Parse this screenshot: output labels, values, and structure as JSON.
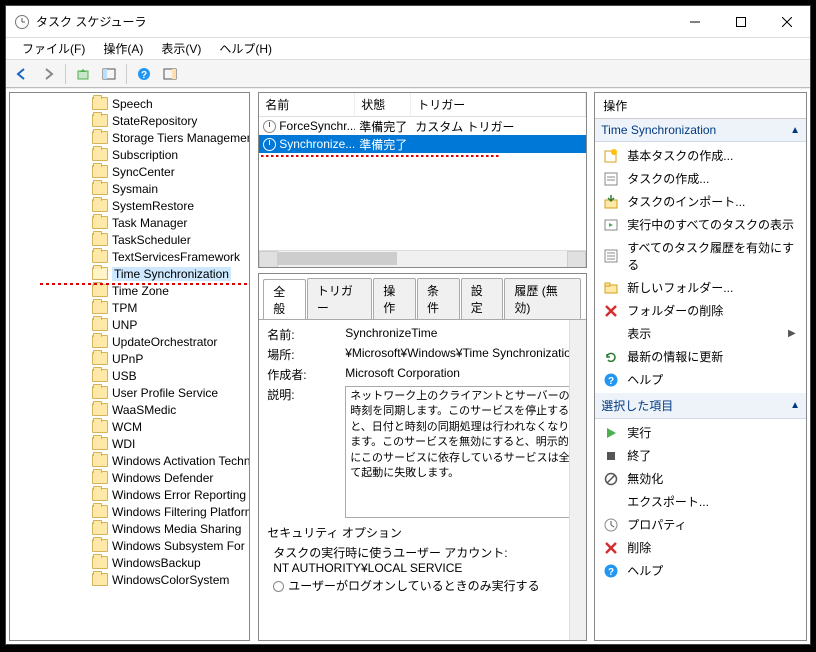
{
  "window": {
    "title": "タスク スケジューラ"
  },
  "menu": {
    "file": "ファイル(F)",
    "action": "操作(A)",
    "view": "表示(V)",
    "help": "ヘルプ(H)"
  },
  "tree": {
    "items": [
      "Speech",
      "StateRepository",
      "Storage Tiers Management",
      "Subscription",
      "SyncCenter",
      "Sysmain",
      "SystemRestore",
      "Task Manager",
      "TaskScheduler",
      "TextServicesFramework",
      "Time Synchronization",
      "Time Zone",
      "TPM",
      "UNP",
      "UpdateOrchestrator",
      "UPnP",
      "USB",
      "User Profile Service",
      "WaaSMedic",
      "WCM",
      "WDI",
      "Windows Activation Technologies",
      "Windows Defender",
      "Windows Error Reporting",
      "Windows Filtering Platform",
      "Windows Media Sharing",
      "Windows Subsystem For Linux",
      "WindowsBackup",
      "WindowsColorSystem"
    ],
    "selected_index": 10
  },
  "task_list": {
    "columns": {
      "name": "名前",
      "status": "状態",
      "trigger": "トリガー"
    },
    "rows": [
      {
        "name": "ForceSynchr...",
        "status": "準備完了",
        "trigger": "カスタム トリガー"
      },
      {
        "name": "Synchronize...",
        "status": "準備完了",
        "trigger": ""
      }
    ],
    "selected_index": 1
  },
  "tabs": {
    "general": "全般",
    "triggers": "トリガー",
    "actions": "操作",
    "conditions": "条件",
    "settings": "設定",
    "history": "履歴 (無効)"
  },
  "detail": {
    "labels": {
      "name": "名前:",
      "location": "場所:",
      "author": "作成者:",
      "description": "説明:"
    },
    "name": "SynchronizeTime",
    "location": "¥Microsoft¥Windows¥Time Synchronization",
    "author": "Microsoft Corporation",
    "description": "ネットワーク上のクライアントとサーバーの時刻を同期します。このサービスを停止すると、日付と時刻の同期処理は行われなくなります。このサービスを無効にすると、明示的にこのサービスに依存しているサービスは全て起動に失敗します。",
    "security": {
      "title": "セキュリティ オプション",
      "account_label": "タスクの実行時に使うユーザー アカウント:",
      "account": "NT AUTHORITY¥LOCAL SERVICE",
      "option_loggedon": "ユーザーがログオンしているときのみ実行する"
    }
  },
  "actions_pane": {
    "header": "操作",
    "section1": "Time Synchronization",
    "section2": "選択した項目",
    "items1": [
      {
        "icon": "new-basic",
        "label": "基本タスクの作成..."
      },
      {
        "icon": "new-task",
        "label": "タスクの作成..."
      },
      {
        "icon": "import",
        "label": "タスクのインポート..."
      },
      {
        "icon": "running",
        "label": "実行中のすべてのタスクの表示"
      },
      {
        "icon": "history",
        "label": "すべてのタスク履歴を有効にする"
      },
      {
        "icon": "new-folder",
        "label": "新しいフォルダー..."
      },
      {
        "icon": "delete-red",
        "label": "フォルダーの削除"
      },
      {
        "icon": "view",
        "label": "表示",
        "sub": true
      },
      {
        "icon": "refresh",
        "label": "最新の情報に更新"
      },
      {
        "icon": "help",
        "label": "ヘルプ"
      }
    ],
    "items2": [
      {
        "icon": "run",
        "label": "実行"
      },
      {
        "icon": "end",
        "label": "終了"
      },
      {
        "icon": "disable",
        "label": "無効化"
      },
      {
        "icon": "export",
        "label": "エクスポート..."
      },
      {
        "icon": "props",
        "label": "プロパティ"
      },
      {
        "icon": "delete-red",
        "label": "削除"
      },
      {
        "icon": "help",
        "label": "ヘルプ"
      }
    ]
  }
}
